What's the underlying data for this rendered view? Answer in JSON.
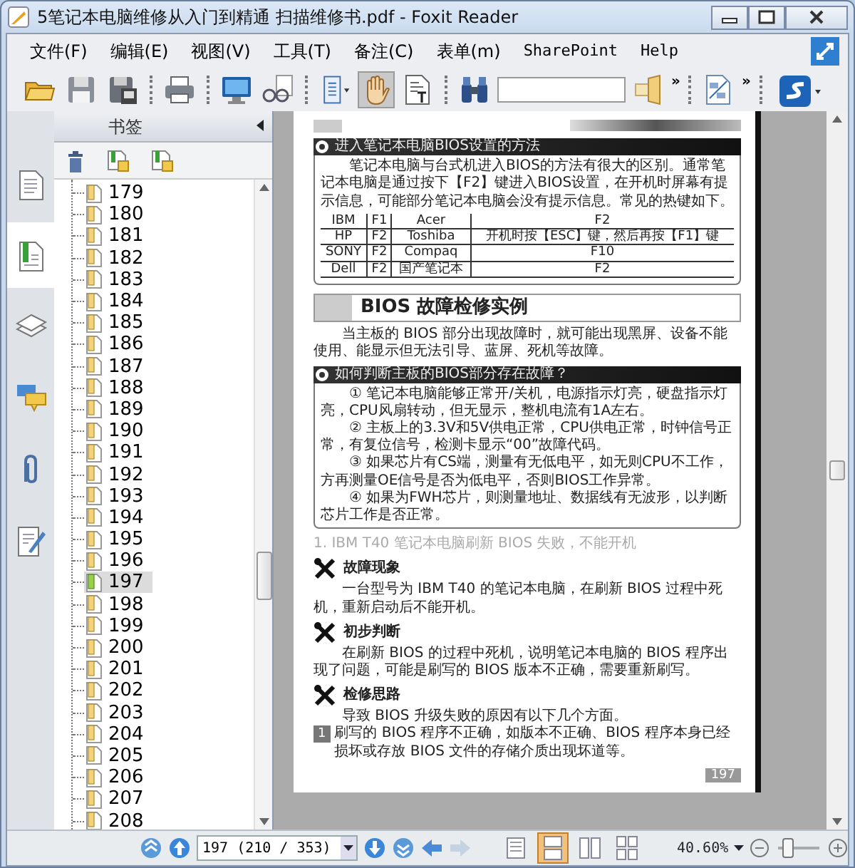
{
  "window": {
    "title": "5笔记本电脑维修从入门到精通 扫描维修书.pdf - Foxit Reader"
  },
  "menu": [
    "文件(F)",
    "编辑(E)",
    "视图(V)",
    "工具(T)",
    "备注(C)",
    "表单(m)",
    "SharePoint",
    "Help"
  ],
  "toolbar": {
    "tools": [
      {
        "kind": "open",
        "selected": false
      },
      {
        "kind": "save",
        "selected": false
      },
      {
        "kind": "save_as",
        "selected": false
      },
      {
        "kind": "sep"
      },
      {
        "kind": "print",
        "selected": false
      },
      {
        "kind": "sep"
      },
      {
        "kind": "fullscreen",
        "selected": false
      },
      {
        "kind": "glasses",
        "selected": false
      },
      {
        "kind": "sep"
      },
      {
        "kind": "page_menu",
        "selected": false
      },
      {
        "kind": "hand",
        "selected": true
      },
      {
        "kind": "text_select",
        "selected": false
      },
      {
        "kind": "sep"
      },
      {
        "kind": "find",
        "selected": false
      },
      {
        "kind": "search_field"
      },
      {
        "kind": "highlight",
        "selected": false
      },
      {
        "kind": "more",
        "label": "»"
      },
      {
        "kind": "sep"
      },
      {
        "kind": "zoom100",
        "selected": false
      },
      {
        "kind": "more",
        "label": "»"
      },
      {
        "kind": "sep"
      },
      {
        "kind": "logo_menu",
        "selected": false
      }
    ]
  },
  "sidebar": {
    "title": "书签",
    "tabs": [
      {
        "kind": "pages",
        "selected": false
      },
      {
        "kind": "bookmarks",
        "selected": true
      },
      {
        "kind": "layers",
        "selected": false
      },
      {
        "kind": "comments",
        "selected": false
      },
      {
        "kind": "attachments",
        "selected": false
      },
      {
        "kind": "signatures",
        "selected": false
      }
    ],
    "bookmarks": [
      {
        "label": "179",
        "selected": false
      },
      {
        "label": "180",
        "selected": false
      },
      {
        "label": "181",
        "selected": false
      },
      {
        "label": "182",
        "selected": false
      },
      {
        "label": "183",
        "selected": false
      },
      {
        "label": "184",
        "selected": false
      },
      {
        "label": "185",
        "selected": false
      },
      {
        "label": "186",
        "selected": false
      },
      {
        "label": "187",
        "selected": false
      },
      {
        "label": "188",
        "selected": false
      },
      {
        "label": "189",
        "selected": false
      },
      {
        "label": "190",
        "selected": false
      },
      {
        "label": "191",
        "selected": false
      },
      {
        "label": "192",
        "selected": false
      },
      {
        "label": "193",
        "selected": false
      },
      {
        "label": "194",
        "selected": false
      },
      {
        "label": "195",
        "selected": false
      },
      {
        "label": "196",
        "selected": false
      },
      {
        "label": "197",
        "selected": true
      },
      {
        "label": "198",
        "selected": false
      },
      {
        "label": "199",
        "selected": false
      },
      {
        "label": "200",
        "selected": false
      },
      {
        "label": "201",
        "selected": false
      },
      {
        "label": "202",
        "selected": false
      },
      {
        "label": "203",
        "selected": false
      },
      {
        "label": "204",
        "selected": false
      },
      {
        "label": "205",
        "selected": false
      },
      {
        "label": "206",
        "selected": false
      },
      {
        "label": "207",
        "selected": false
      },
      {
        "label": "208",
        "selected": false
      }
    ]
  },
  "document": {
    "blocks": [
      {
        "kind": "box",
        "title": "进入笔记本电脑BIOS设置的方法",
        "blocks": [
          {
            "kind": "para",
            "text": "笔记本电脑与台式机进入BIOS的方法有很大的区别。通常笔记本电脑是通过按下【F2】键进入BIOS设置，在开机时屏幕有提示信息，可能部分笔记本电脑会没有提示信息。常见的热键如下。"
          },
          {
            "kind": "table",
            "rows": [
              [
                "IBM",
                "F1",
                "Acer",
                "F2"
              ],
              [
                "HP",
                "F2",
                "Toshiba",
                "开机时按【ESC】键，然后再按【F1】键"
              ],
              [
                "SONY",
                "F2",
                "Compaq",
                "F10"
              ],
              [
                "Dell",
                "F2",
                "国产笔记本",
                "F2"
              ]
            ]
          }
        ]
      },
      {
        "kind": "heading",
        "text": "BIOS 故障检修实例"
      },
      {
        "kind": "para",
        "text": "当主板的 BIOS 部分出现故障时，就可能出现黑屏、设备不能使用、能显示但无法引导、蓝屏、死机等故障。"
      },
      {
        "kind": "box",
        "title": "如何判断主板的BIOS部分存在故障？",
        "blocks": [
          {
            "kind": "para",
            "text": "① 笔记本电脑能够正常开/关机，电源指示灯亮，硬盘指示灯亮，CPU风扇转动，但无显示，整机电流有1A左右。"
          },
          {
            "kind": "para",
            "text": "② 主板上的3.3V和5V供电正常，CPU供电正常，时钟信号正常，有复位信号，检测卡显示“00”故障代码。"
          },
          {
            "kind": "para",
            "text": "③ 如果芯片有CS端，测量有无低电平，如无则CPU不工作，方再测量OE信号是否为低电平，否则BIOS工作异常。"
          },
          {
            "kind": "para",
            "text": "④ 如果为FWH芯片，则测量地址、数据线有无波形，以判断芯片工作是否正常。"
          }
        ]
      },
      {
        "kind": "subheading",
        "text": "1. IBM T40 笔记本电脑刷新 BIOS 失败，不能开机"
      },
      {
        "kind": "tool_heading",
        "text": "故障现象"
      },
      {
        "kind": "para",
        "text": "一台型号为 IBM T40 的笔记本电脑，在刷新 BIOS 过程中死机，重新启动后不能开机。"
      },
      {
        "kind": "tool_heading",
        "text": "初步判断"
      },
      {
        "kind": "para",
        "text": "在刷新 BIOS 的过程中死机，说明笔记本电脑的 BIOS 程序出现了问题，可能是刷写的 BIOS 版本不正确，需要重新刷写。"
      },
      {
        "kind": "tool_heading",
        "text": "检修思路"
      },
      {
        "kind": "para",
        "text": "导致 BIOS 升级失败的原因有以下几个方面。"
      },
      {
        "kind": "numbered",
        "number": "1",
        "text": "刷写的 BIOS 程序不正确，如版本不正确、BIOS 程序本身已经损坏或存放 BIOS 文件的存储介质出现坏道等。"
      }
    ],
    "page_number": "197"
  },
  "status_bar": {
    "page_field": "197 (210 / 353)",
    "nav": [
      {
        "kind": "first",
        "disabled": false
      },
      {
        "kind": "prev",
        "disabled": false
      },
      {
        "kind": "page_field"
      },
      {
        "kind": "next",
        "disabled": false
      },
      {
        "kind": "last",
        "disabled": false
      },
      {
        "kind": "back",
        "disabled": false
      },
      {
        "kind": "forward",
        "disabled": true
      }
    ],
    "view_modes": [
      {
        "kind": "single",
        "selected": false
      },
      {
        "kind": "continuous",
        "selected": true
      },
      {
        "kind": "facing",
        "selected": false
      },
      {
        "kind": "continuous_facing",
        "selected": false
      }
    ],
    "zoom": "40.60%",
    "zoom_slider": {
      "level": 0.15
    }
  }
}
